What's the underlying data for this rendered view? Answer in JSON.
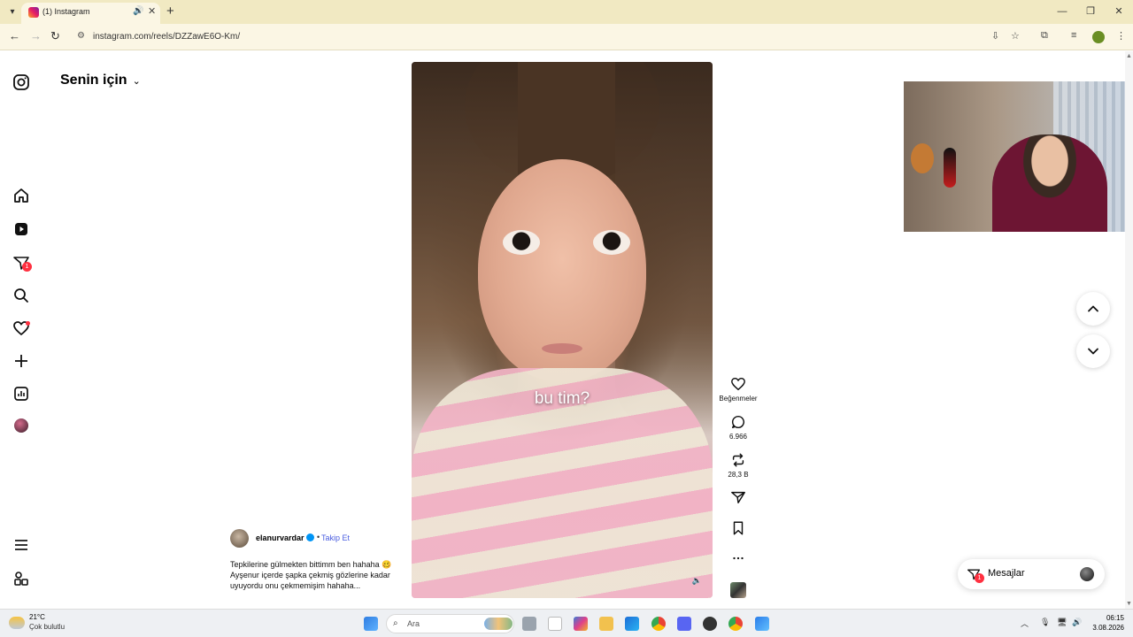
{
  "browser": {
    "tab_title": "(1) Instagram",
    "url": "instagram.com/reels/DZZawE6O-Km/"
  },
  "feed": {
    "title": "Senin için"
  },
  "nav_badges": {
    "messages": "1"
  },
  "reel": {
    "caption_text": "bu tim?"
  },
  "actions": {
    "likes_label": "Beğenmeler",
    "comments_count": "6.966",
    "reposts_count": "28,3 B"
  },
  "author": {
    "username": "elanurvardar",
    "separator": "•",
    "follow_label": "Takip Et",
    "description": "Tepkilerine gülmekten bittimm ben hahaha 🥴 Ayşenur içerde şapka çekmiş gözlerine kadar uyuyordu onu çekmemişim hahaha..."
  },
  "messages": {
    "label": "Mesajlar",
    "badge": "1"
  },
  "taskbar": {
    "temperature": "21°C",
    "condition": "Çok bulutlu",
    "search_placeholder": "Ara",
    "time": "06:15",
    "date": "3.08.2026"
  },
  "colors": {
    "accent_blue": "#4a5de0",
    "badge_red": "#ff3040",
    "tab_bar": "#f1e9c2"
  }
}
